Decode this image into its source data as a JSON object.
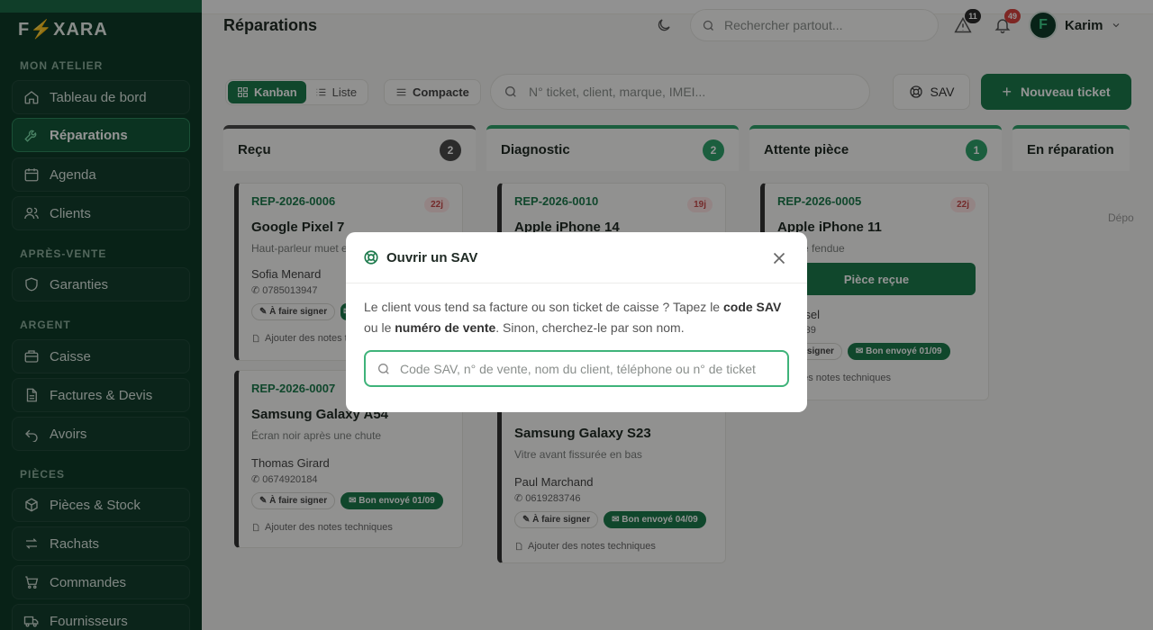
{
  "sidebar": {
    "logo": "F⚡XARA",
    "sections": [
      "MON ATELIER",
      "APRÈS-VENTE",
      "ARGENT",
      "PIÈCES"
    ],
    "items": [
      "Tableau de bord",
      "Réparations",
      "Agenda",
      "Clients",
      "Garanties",
      "Caisse",
      "Factures & Devis",
      "Avoirs",
      "Pièces & Stock",
      "Rachats",
      "Commandes",
      "Fournisseurs"
    ]
  },
  "header": {
    "title": "Réparations",
    "search_placeholder": "Rechercher partout...",
    "alerts_count": "11",
    "notif_count": "49",
    "user_initial": "F",
    "user_name": "Karim"
  },
  "toolbar": {
    "kanban": "Kanban",
    "liste": "Liste",
    "compacte": "Compacte",
    "filter_placeholder": "N° ticket, client, marque, IMEI...",
    "sav": "SAV",
    "new_ticket": "Nouveau ticket"
  },
  "columns": [
    {
      "title": "Reçu",
      "count": "2",
      "color": "#4a4a4a"
    },
    {
      "title": "Diagnostic",
      "count": "2",
      "color": "#2fa36b"
    },
    {
      "title": "Attente pièce",
      "count": "1",
      "color": "#2fa36b"
    },
    {
      "title": "En réparation",
      "count": "",
      "color": "#2fa36b"
    }
  ],
  "cards": {
    "c1": {
      "ref": "REP-2026-0006",
      "age": "22j",
      "device": "Google Pixel 7",
      "issue": "Haut-parleur muet e",
      "client": "Sofia Menard",
      "phone": "0785013947",
      "tag1": "À faire signer",
      "notes": "Ajouter des notes t"
    },
    "c2": {
      "ref": "REP-2026-0007",
      "device": "Samsung Galaxy A54",
      "issue": "Écran noir après une chute",
      "client": "Thomas Girard",
      "phone": "0674920184",
      "tag1": "À faire signer",
      "tag2": "Bon envoyé 01/09",
      "notes": "Ajouter des notes techniques"
    },
    "c3": {
      "ref": "REP-2026-0010",
      "age": "19j",
      "device": "Apple iPhone 14"
    },
    "c4": {
      "device": "Samsung Galaxy S23",
      "issue": "Vitre avant fissurée en bas",
      "client": "Paul Marchand",
      "phone": "0619283746",
      "tag1": "À faire signer",
      "tag2": "Bon envoyé 04/09",
      "notes": "Ajouter des notes techniques"
    },
    "c5": {
      "ref": "REP-2026-0005",
      "age": "22j",
      "device": "Apple iPhone 11",
      "issue": "arrière fendue",
      "action": "Pièce reçue",
      "client": "Roussel",
      "phone": "8471039",
      "tag1": "faire signer",
      "tag2": "Bon envoyé 01/09",
      "notes": "uter des notes techniques"
    }
  },
  "empty_col_text": "Dépo",
  "modal": {
    "title": "Ouvrir un SAV",
    "text_1": "Le client vous tend sa facture ou son ticket de caisse ? Tapez le ",
    "bold_1": "code SAV",
    "text_2": " ou le ",
    "bold_2": "numéro de vente",
    "text_3": ". Sinon, cherchez-le par son nom.",
    "input_placeholder": "Code SAV, n° de vente, nom du client, téléphone ou n° de ticket"
  }
}
